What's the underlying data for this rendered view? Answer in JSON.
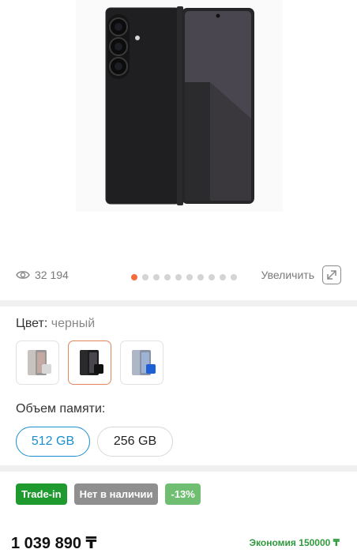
{
  "gallery": {
    "views_count": "32 194",
    "zoom_label": "Увеличить",
    "dots_total": 10,
    "active_dot": 1
  },
  "color": {
    "label": "Цвет:",
    "value": "черный",
    "options": [
      {
        "name": "silver"
      },
      {
        "name": "black",
        "selected": true
      },
      {
        "name": "blue"
      }
    ]
  },
  "memory": {
    "label": "Объем памяти:",
    "options": [
      {
        "label": "512 GB",
        "selected": true
      },
      {
        "label": "256 GB",
        "selected": false
      }
    ]
  },
  "badges": [
    {
      "label": "Trade-in",
      "color": "#1e9a2e"
    },
    {
      "label": "Нет в наличии",
      "color": "#8f8f8f"
    },
    {
      "label": "-13%",
      "color": "#6fbe72"
    }
  ],
  "price": {
    "value": "1 039 890 ₸",
    "economy": "Экономия 150000 ₸",
    "economy_color": "#2e9a3c"
  },
  "colors": {
    "accent": "#1a8fcf",
    "active_dot": "#f26c3d",
    "selected_swatch": "#e0865a"
  }
}
